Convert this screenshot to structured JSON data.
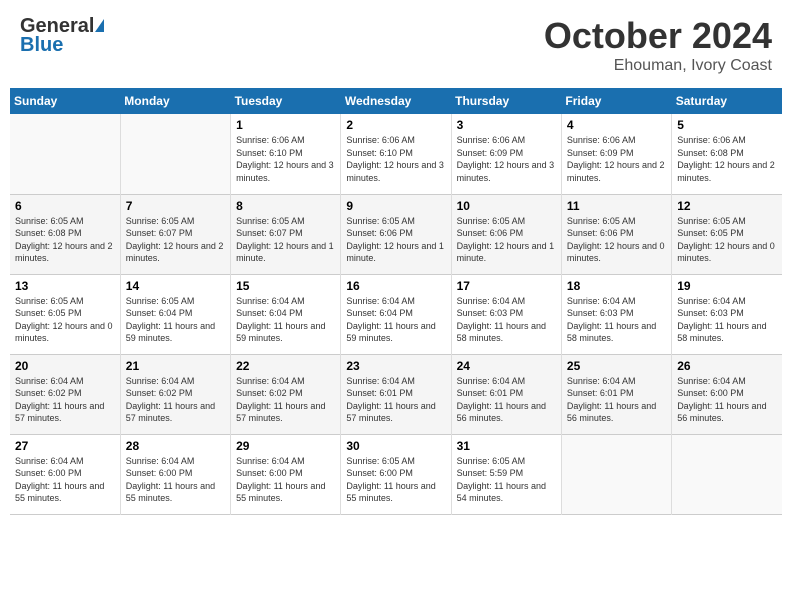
{
  "header": {
    "logo_general": "General",
    "logo_blue": "Blue",
    "month": "October 2024",
    "location": "Ehouman, Ivory Coast"
  },
  "days_of_week": [
    "Sunday",
    "Monday",
    "Tuesday",
    "Wednesday",
    "Thursday",
    "Friday",
    "Saturday"
  ],
  "weeks": [
    [
      {
        "day": "",
        "info": ""
      },
      {
        "day": "",
        "info": ""
      },
      {
        "day": "1",
        "info": "Sunrise: 6:06 AM\nSunset: 6:10 PM\nDaylight: 12 hours and 3 minutes."
      },
      {
        "day": "2",
        "info": "Sunrise: 6:06 AM\nSunset: 6:10 PM\nDaylight: 12 hours and 3 minutes."
      },
      {
        "day": "3",
        "info": "Sunrise: 6:06 AM\nSunset: 6:09 PM\nDaylight: 12 hours and 3 minutes."
      },
      {
        "day": "4",
        "info": "Sunrise: 6:06 AM\nSunset: 6:09 PM\nDaylight: 12 hours and 2 minutes."
      },
      {
        "day": "5",
        "info": "Sunrise: 6:06 AM\nSunset: 6:08 PM\nDaylight: 12 hours and 2 minutes."
      }
    ],
    [
      {
        "day": "6",
        "info": "Sunrise: 6:05 AM\nSunset: 6:08 PM\nDaylight: 12 hours and 2 minutes."
      },
      {
        "day": "7",
        "info": "Sunrise: 6:05 AM\nSunset: 6:07 PM\nDaylight: 12 hours and 2 minutes."
      },
      {
        "day": "8",
        "info": "Sunrise: 6:05 AM\nSunset: 6:07 PM\nDaylight: 12 hours and 1 minute."
      },
      {
        "day": "9",
        "info": "Sunrise: 6:05 AM\nSunset: 6:06 PM\nDaylight: 12 hours and 1 minute."
      },
      {
        "day": "10",
        "info": "Sunrise: 6:05 AM\nSunset: 6:06 PM\nDaylight: 12 hours and 1 minute."
      },
      {
        "day": "11",
        "info": "Sunrise: 6:05 AM\nSunset: 6:06 PM\nDaylight: 12 hours and 0 minutes."
      },
      {
        "day": "12",
        "info": "Sunrise: 6:05 AM\nSunset: 6:05 PM\nDaylight: 12 hours and 0 minutes."
      }
    ],
    [
      {
        "day": "13",
        "info": "Sunrise: 6:05 AM\nSunset: 6:05 PM\nDaylight: 12 hours and 0 minutes."
      },
      {
        "day": "14",
        "info": "Sunrise: 6:05 AM\nSunset: 6:04 PM\nDaylight: 11 hours and 59 minutes."
      },
      {
        "day": "15",
        "info": "Sunrise: 6:04 AM\nSunset: 6:04 PM\nDaylight: 11 hours and 59 minutes."
      },
      {
        "day": "16",
        "info": "Sunrise: 6:04 AM\nSunset: 6:04 PM\nDaylight: 11 hours and 59 minutes."
      },
      {
        "day": "17",
        "info": "Sunrise: 6:04 AM\nSunset: 6:03 PM\nDaylight: 11 hours and 58 minutes."
      },
      {
        "day": "18",
        "info": "Sunrise: 6:04 AM\nSunset: 6:03 PM\nDaylight: 11 hours and 58 minutes."
      },
      {
        "day": "19",
        "info": "Sunrise: 6:04 AM\nSunset: 6:03 PM\nDaylight: 11 hours and 58 minutes."
      }
    ],
    [
      {
        "day": "20",
        "info": "Sunrise: 6:04 AM\nSunset: 6:02 PM\nDaylight: 11 hours and 57 minutes."
      },
      {
        "day": "21",
        "info": "Sunrise: 6:04 AM\nSunset: 6:02 PM\nDaylight: 11 hours and 57 minutes."
      },
      {
        "day": "22",
        "info": "Sunrise: 6:04 AM\nSunset: 6:02 PM\nDaylight: 11 hours and 57 minutes."
      },
      {
        "day": "23",
        "info": "Sunrise: 6:04 AM\nSunset: 6:01 PM\nDaylight: 11 hours and 57 minutes."
      },
      {
        "day": "24",
        "info": "Sunrise: 6:04 AM\nSunset: 6:01 PM\nDaylight: 11 hours and 56 minutes."
      },
      {
        "day": "25",
        "info": "Sunrise: 6:04 AM\nSunset: 6:01 PM\nDaylight: 11 hours and 56 minutes."
      },
      {
        "day": "26",
        "info": "Sunrise: 6:04 AM\nSunset: 6:00 PM\nDaylight: 11 hours and 56 minutes."
      }
    ],
    [
      {
        "day": "27",
        "info": "Sunrise: 6:04 AM\nSunset: 6:00 PM\nDaylight: 11 hours and 55 minutes."
      },
      {
        "day": "28",
        "info": "Sunrise: 6:04 AM\nSunset: 6:00 PM\nDaylight: 11 hours and 55 minutes."
      },
      {
        "day": "29",
        "info": "Sunrise: 6:04 AM\nSunset: 6:00 PM\nDaylight: 11 hours and 55 minutes."
      },
      {
        "day": "30",
        "info": "Sunrise: 6:05 AM\nSunset: 6:00 PM\nDaylight: 11 hours and 55 minutes."
      },
      {
        "day": "31",
        "info": "Sunrise: 6:05 AM\nSunset: 5:59 PM\nDaylight: 11 hours and 54 minutes."
      },
      {
        "day": "",
        "info": ""
      },
      {
        "day": "",
        "info": ""
      }
    ]
  ]
}
